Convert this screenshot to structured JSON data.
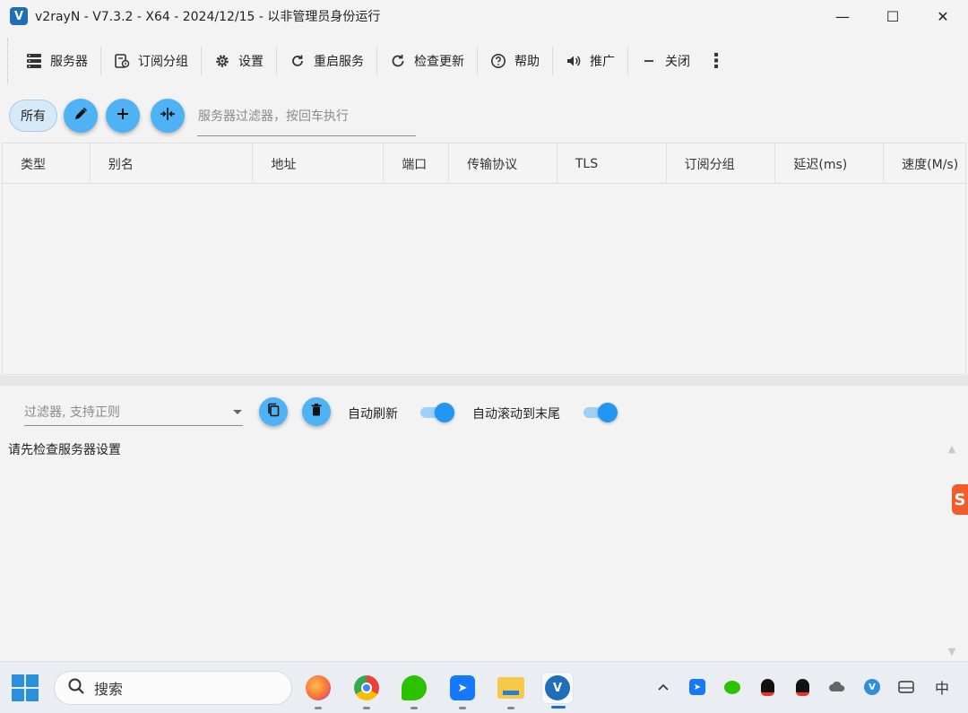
{
  "window": {
    "title": "v2rayN - V7.3.2 - X64 - 2024/12/15 - 以非管理员身份运行",
    "logo_letter": "V",
    "controls": {
      "minimize": "—",
      "maximize": "☐",
      "close": "✕"
    }
  },
  "toolbar": {
    "items": [
      {
        "label": "服务器",
        "icon": "server-icon"
      },
      {
        "label": "订阅分组",
        "icon": "subscription-icon"
      },
      {
        "label": "设置",
        "icon": "gear-icon"
      },
      {
        "label": "重启服务",
        "icon": "restart-icon"
      },
      {
        "label": "检查更新",
        "icon": "update-icon"
      },
      {
        "label": "帮助",
        "icon": "help-icon"
      },
      {
        "label": "推广",
        "icon": "speaker-icon"
      },
      {
        "label": "关闭",
        "icon": "minus-icon"
      }
    ]
  },
  "filter_bar": {
    "all_chip": "所有",
    "server_filter_placeholder": "服务器过滤器，按回车执行"
  },
  "server_table": {
    "columns": [
      "类型",
      "别名",
      "地址",
      "端口",
      "传输协议",
      "TLS",
      "订阅分组",
      "延迟(ms)",
      "速度(M/s)"
    ],
    "rows": []
  },
  "log_panel": {
    "filter_placeholder": "过滤器, 支持正则",
    "auto_refresh_label": "自动刷新",
    "auto_refresh": true,
    "auto_scroll_label": "自动滚动到末尾",
    "auto_scroll": true,
    "message": "请先检查服务器设置"
  },
  "taskbar": {
    "search_label": "搜索",
    "ime_label": "中",
    "apps": [
      "firefox-icon",
      "chrome-icon",
      "wechat-icon",
      "feishu-icon",
      "file-explorer-icon",
      "v2rayn-icon"
    ],
    "active_app": "v2rayn-icon"
  },
  "colors": {
    "accent": "#4fb2f5",
    "toggle_on": "#2196f3",
    "chip_bg": "#d6e9f8"
  }
}
